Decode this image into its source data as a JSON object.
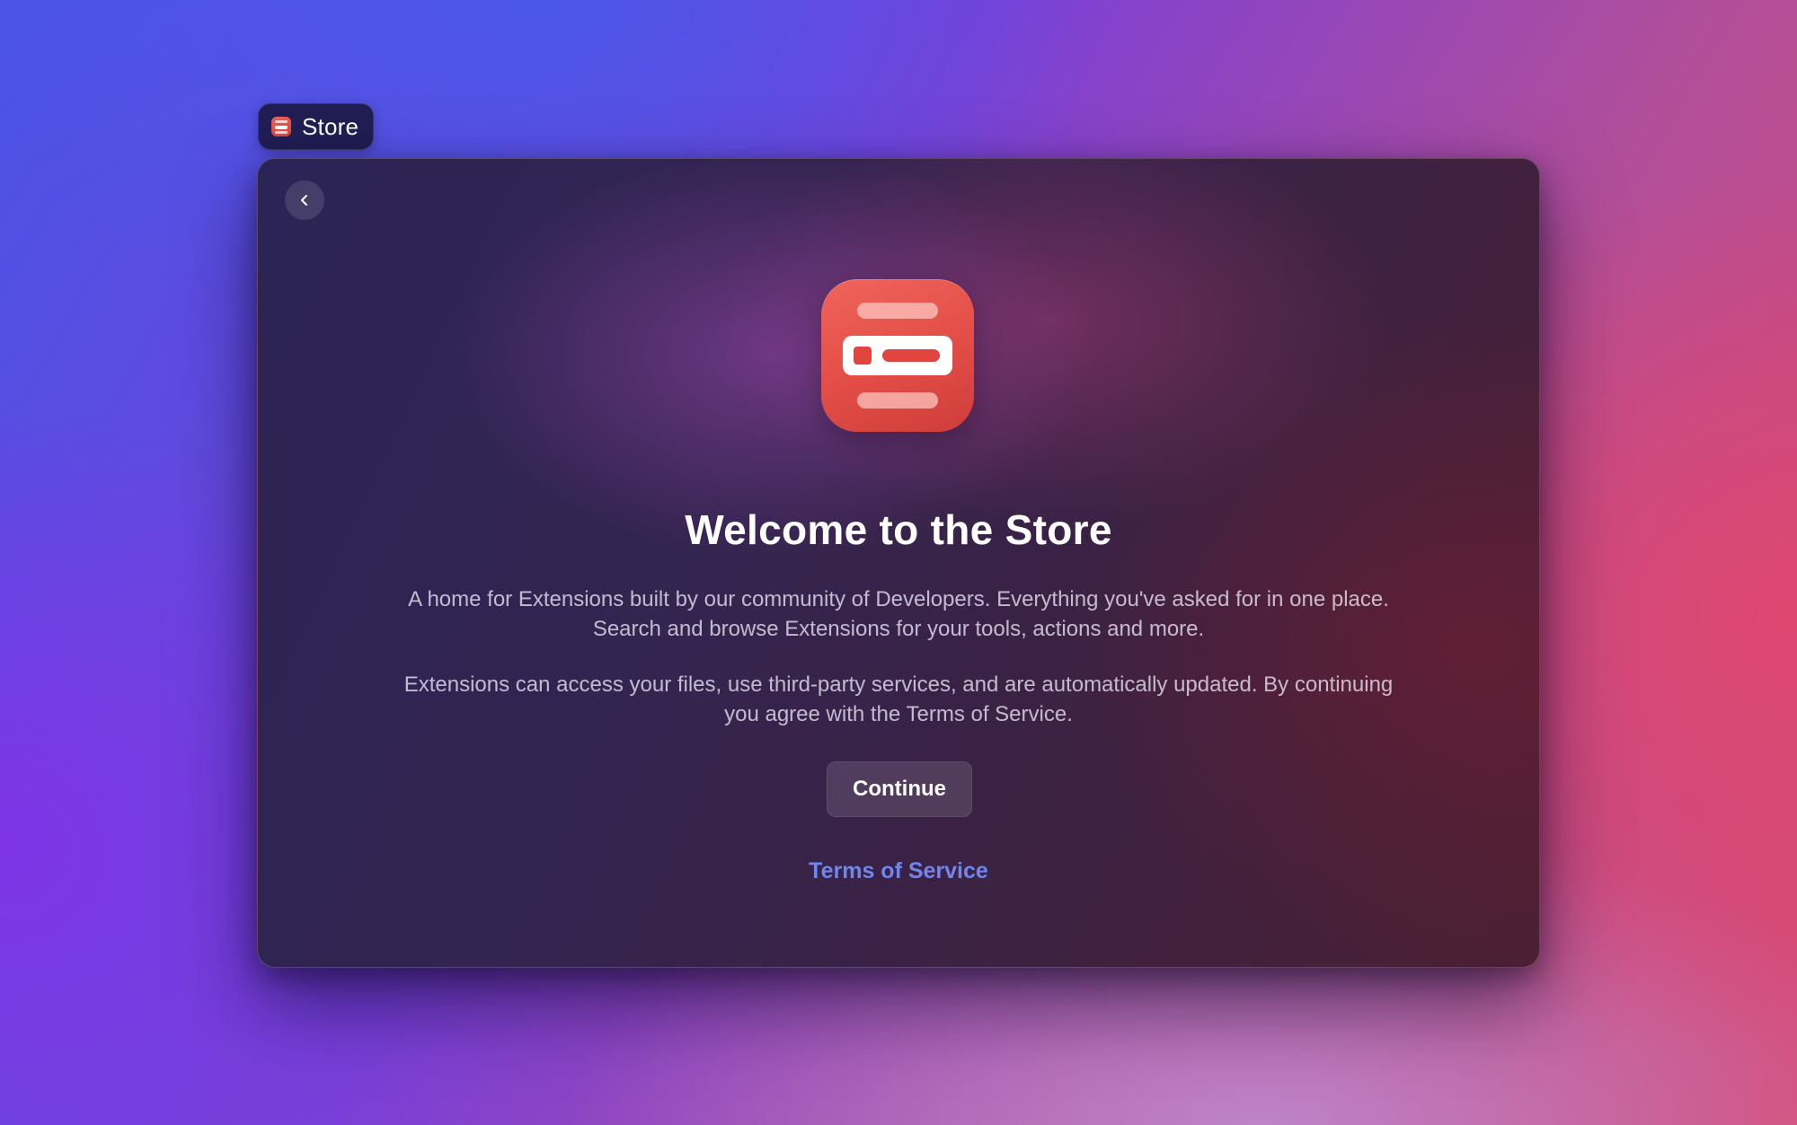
{
  "command_bar": {
    "label": "Store",
    "icon": "store-icon"
  },
  "window": {
    "back_icon": "chevron-left-icon",
    "app_icon": "store-app-icon",
    "title": "Welcome to the Store",
    "description_1": "A home for Extensions built by our community of Developers. Everything you've asked for in one place. Search and browse Extensions for your tools, actions and more.",
    "description_2": "Extensions can access your files, use third-party services, and are automatically updated. By continuing you agree with the Terms of Service.",
    "continue_label": "Continue",
    "terms_link": "Terms of Service"
  },
  "colors": {
    "accent_link": "#6f86f0",
    "icon_red": "#e24d46"
  }
}
